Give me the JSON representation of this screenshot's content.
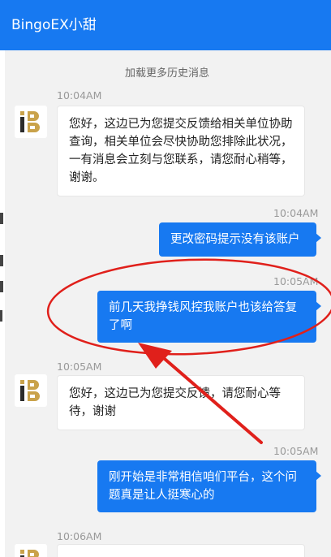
{
  "header": {
    "title": "BingoEX小甜"
  },
  "chat": {
    "load_more": "加载更多历史消息",
    "messages": [
      {
        "time": "10:04AM",
        "from": "agent",
        "text": "您好，这边已为您提交反馈给相关单位协助查询，相关单位会尽快协助您排除此状况，一有消息会立刻与您联系，请您耐心稍等，谢谢。"
      },
      {
        "time": "10:04AM",
        "from": "user",
        "text": "更改密码提示没有该账户"
      },
      {
        "time": "10:05AM",
        "from": "user",
        "text": "前几天我挣钱风控我账户也该给答复了啊"
      },
      {
        "time": "10:05AM",
        "from": "agent",
        "text": "您好，这边已为您提交反馈，请您耐心等待，谢谢"
      },
      {
        "time": "10:05AM",
        "from": "user",
        "text": "刚开始是非常相信咱们平台，这个问题真是让人挺寒心的"
      },
      {
        "time": "10:06AM",
        "from": "agent",
        "text": ""
      }
    ]
  },
  "colors": {
    "accent": "#1779f1",
    "annotation": "#e0201b",
    "logo_gold": "#c9a24a",
    "logo_dark": "#2b2b2b"
  }
}
